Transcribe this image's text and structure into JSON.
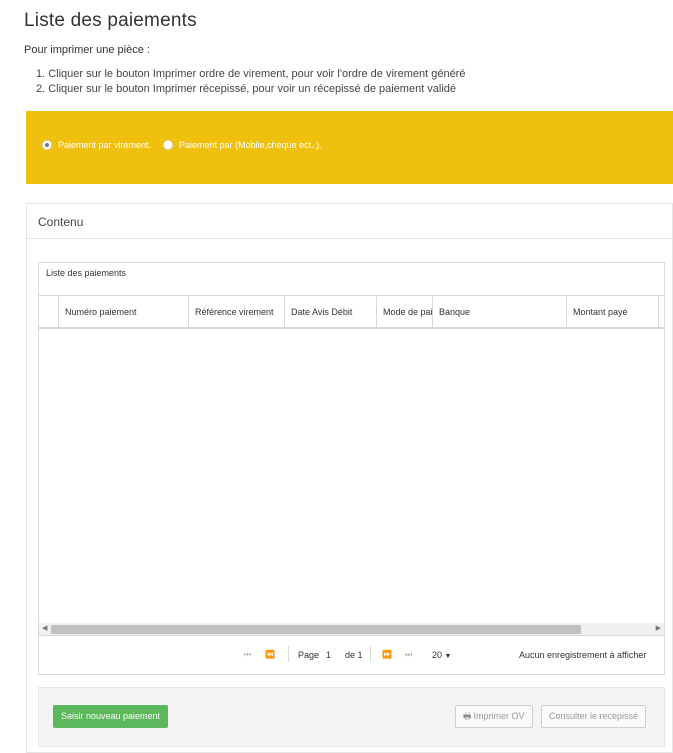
{
  "page": {
    "title": "Liste des paiements",
    "intro": "Pour imprimer une pièce :",
    "steps": [
      "1. Cliquer sur le bouton Imprimer ordre de virement, pour voir l'ordre de virement généré",
      "2. Cliquer sur le bouton Imprimer récepissé, pour voir un récepissé de paiement validé"
    ]
  },
  "payment_type": {
    "options": [
      {
        "label": "Paiement par virement.",
        "checked": true
      },
      {
        "label": "Paiement par (Mobile,cheque ect..).",
        "checked": false
      }
    ]
  },
  "panel": {
    "title": "Contenu",
    "grid": {
      "caption": "Liste des paiements",
      "columns": [
        "Numéro paiement",
        "Référence virement",
        "Date Avis Débit",
        "Mode de paiement",
        "Banque",
        "Montant payé"
      ],
      "rows": []
    },
    "pager": {
      "page_label": "Page",
      "page_value": "1",
      "of_label": "de 1",
      "page_size": "20",
      "empty_message": "Aucun enregistrement à afficher"
    },
    "buttons": {
      "new_payment": "Saisir nouveau paiement",
      "print_ov": "Imprimer OV",
      "view_receipt": "Consulter le recepissé"
    }
  },
  "colors": {
    "banner": "#efc10e",
    "primary_button": "#5cb85c"
  }
}
